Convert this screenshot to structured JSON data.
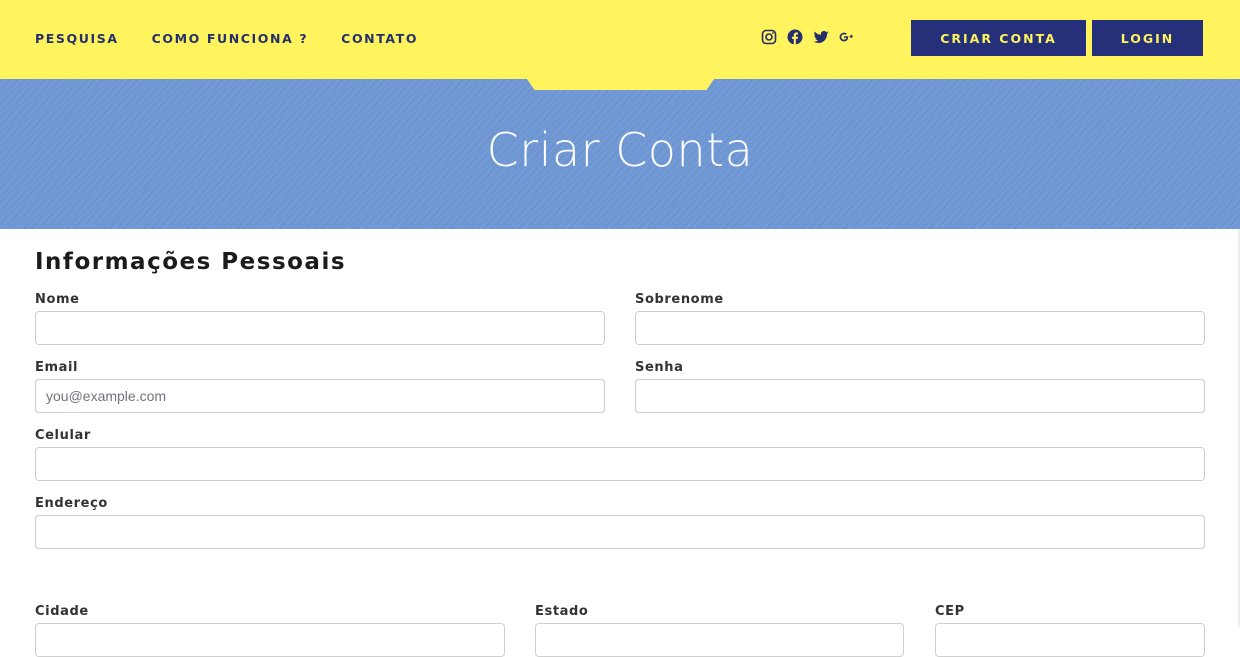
{
  "nav": {
    "links": [
      "PESQUISA",
      "COMO FUNCIONA ?",
      "CONTATO"
    ],
    "social_icons": [
      "instagram-icon",
      "facebook-icon",
      "twitter-icon",
      "google-plus-icon"
    ],
    "create_account_label": "CRIAR CONTA",
    "login_label": "LOGIN"
  },
  "hero": {
    "title": "Criar Conta"
  },
  "form": {
    "section_title": "Informações Pessoais",
    "fields": {
      "nome": {
        "label": "Nome",
        "value": "",
        "placeholder": ""
      },
      "sobrenome": {
        "label": "Sobrenome",
        "value": "",
        "placeholder": ""
      },
      "email": {
        "label": "Email",
        "value": "",
        "placeholder": "you@example.com"
      },
      "senha": {
        "label": "Senha",
        "value": "",
        "placeholder": ""
      },
      "celular": {
        "label": "Celular",
        "value": "",
        "placeholder": ""
      },
      "endereco": {
        "label": "Endereço",
        "value": "",
        "placeholder": ""
      },
      "cidade": {
        "label": "Cidade",
        "value": "",
        "placeholder": ""
      },
      "estado": {
        "label": "Estado",
        "value": "",
        "placeholder": ""
      },
      "cep": {
        "label": "CEP",
        "value": "",
        "placeholder": ""
      }
    }
  },
  "colors": {
    "nav_bg": "#fff35e",
    "nav_text": "#252f6b",
    "button_bg": "#252f7a",
    "button_text": "#fff35e",
    "hero_bg": "#6f97d4"
  }
}
